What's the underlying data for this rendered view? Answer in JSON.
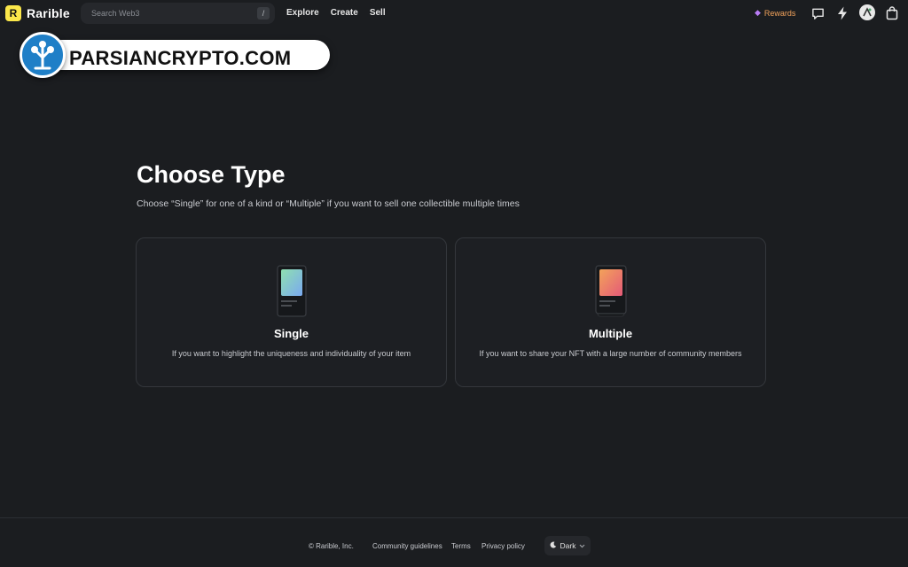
{
  "header": {
    "brand": "Rarible",
    "logo_letter": "R",
    "search_placeholder": "Search Web3",
    "search_shortcut": "/",
    "nav": [
      "Explore",
      "Create",
      "Sell"
    ],
    "rewards_label": "Rewards",
    "icons": [
      "chat-icon",
      "bolt-icon",
      "avatar",
      "bag-icon"
    ]
  },
  "watermark": {
    "text": "PARSIANCRYPTO.COM"
  },
  "main": {
    "title": "Choose Type",
    "subtitle": "Choose “Single” for one of a kind or “Multiple” if you want to sell one collectible multiple times",
    "cards": [
      {
        "title": "Single",
        "description": "If you want to highlight the uniqueness and individuality of your item"
      },
      {
        "title": "Multiple",
        "description": "If you want to share your NFT with a large number of community members"
      }
    ]
  },
  "footer": {
    "copyright": "© Rarible, Inc.",
    "links": [
      "Community guidelines",
      "Terms",
      "Privacy policy"
    ],
    "theme_label": "Dark"
  },
  "colors": {
    "background": "#1b1d20",
    "brand_yellow": "#fbe74a",
    "rewards_orange": "#f0a15a",
    "watermark_blue": "#1f7fc7"
  }
}
